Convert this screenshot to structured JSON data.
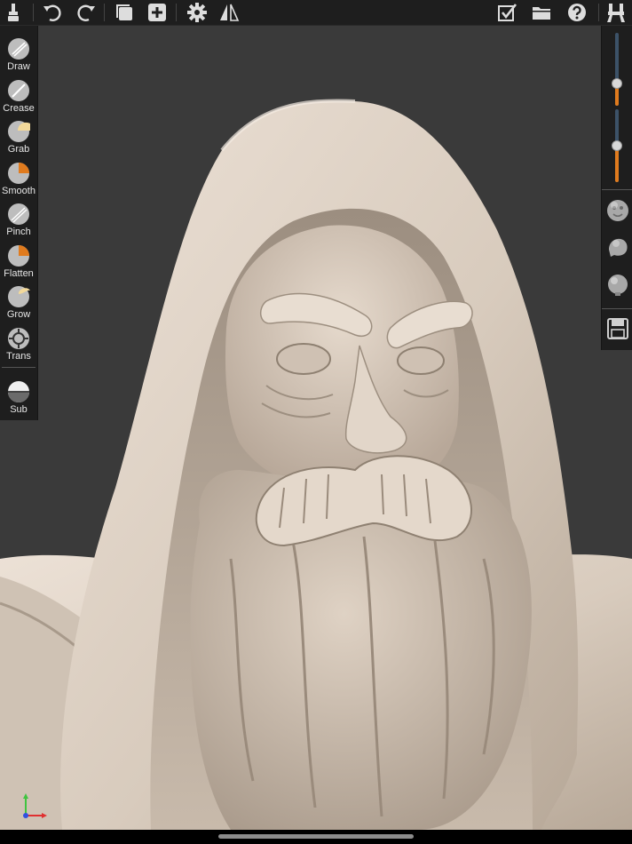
{
  "toolbar": {
    "left_icons": [
      "brush-menu-icon",
      "undo-icon",
      "redo-icon",
      "layers-icon",
      "add-icon",
      "settings-icon",
      "symmetry-icon"
    ],
    "right_icons": [
      "checkbox-icon",
      "folder-icon",
      "help-icon",
      "picker-icon"
    ]
  },
  "tools": [
    {
      "label": "Draw",
      "icon": "draw-icon"
    },
    {
      "label": "Crease",
      "icon": "crease-icon"
    },
    {
      "label": "Grab",
      "icon": "grab-icon"
    },
    {
      "label": "Smooth",
      "icon": "smooth-icon"
    },
    {
      "label": "Pinch",
      "icon": "pinch-icon"
    },
    {
      "label": "Flatten",
      "icon": "flatten-icon"
    },
    {
      "label": "Grow",
      "icon": "grow-icon"
    },
    {
      "label": "Trans",
      "icon": "transform-icon"
    },
    {
      "label": "Sub",
      "icon": "subdivide-icon"
    }
  ],
  "sliders": {
    "radius_level": 0.3,
    "intensity_level": 0.5
  },
  "right_panel": {
    "icons": [
      "matcap-face-icon",
      "matcap-head-icon",
      "matcap-sphere-icon",
      "save-icon"
    ]
  },
  "colors": {
    "accent": "#e07b1e",
    "track": "#3c5268",
    "panel": "#1e1e1e",
    "viewport": "#3a3a3a",
    "clay": "#dccfc3"
  }
}
